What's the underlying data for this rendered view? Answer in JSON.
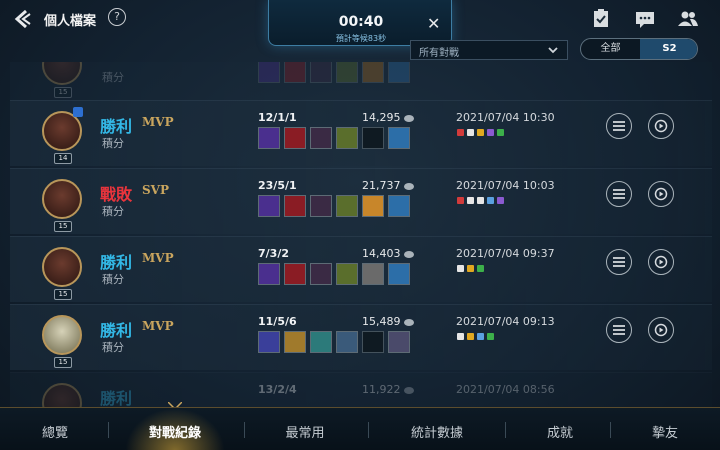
{
  "header": {
    "title": "個人檔案",
    "help_icon": "help-icon",
    "right_icons": [
      "clipboard-icon",
      "chat-icon",
      "friends-icon"
    ]
  },
  "queue": {
    "timer": "00:40",
    "estimate": "預計等候83秒"
  },
  "filter": {
    "mode_value": "所有對戰",
    "seasons": [
      "全部",
      "S2"
    ],
    "selected_season": "S2"
  },
  "matches": [
    {
      "result": "",
      "grade": "",
      "sub": "積分",
      "level": "15",
      "kda": "",
      "score": "",
      "date": "",
      "faded": true
    },
    {
      "result": "勝利",
      "grade": "MVP",
      "sub": "積分",
      "level": "14",
      "kda": "12/1/1",
      "score": "14,295",
      "date": "2021/07/04 10:30",
      "outcome": "win"
    },
    {
      "result": "戰敗",
      "grade": "SVP",
      "sub": "積分",
      "level": "15",
      "kda": "23/5/1",
      "score": "21,737",
      "date": "2021/07/04 10:03",
      "outcome": "lose"
    },
    {
      "result": "勝利",
      "grade": "MVP",
      "sub": "積分",
      "level": "15",
      "kda": "7/3/2",
      "score": "14,403",
      "date": "2021/07/04 09:37",
      "outcome": "win"
    },
    {
      "result": "勝利",
      "grade": "MVP",
      "sub": "積分",
      "level": "15",
      "kda": "11/5/6",
      "score": "15,489",
      "date": "2021/07/04 09:13",
      "outcome": "win"
    },
    {
      "result": "勝利",
      "grade": "",
      "sub": "",
      "level": "",
      "kda": "13/2/4",
      "score": "11,922",
      "date": "2021/07/04 08:56",
      "outcome": "win",
      "faded": true
    }
  ],
  "colors": {
    "win": "#33b8e6",
    "lose": "#e8343c",
    "gold": "#c9a55e"
  },
  "tabs": [
    "總覽",
    "對戰紀錄",
    "最常用",
    "統計數據",
    "成就",
    "摯友"
  ],
  "active_tab": "對戰紀錄"
}
